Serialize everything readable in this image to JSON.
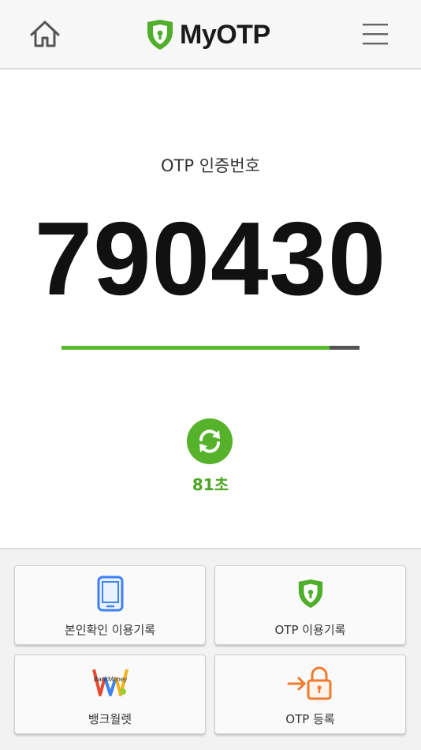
{
  "header": {
    "app_name": "MyOTP",
    "home_icon": "home-icon",
    "menu_icon": "hamburger-menu-icon",
    "brand_color": "#4fae2a"
  },
  "otp": {
    "label": "OTP 인증번호",
    "code": "790430",
    "progress_fraction": 0.9,
    "progress_color": "#5cb82e",
    "remaining_text": "81초",
    "refresh_icon": "refresh-icon"
  },
  "menu_tiles": [
    {
      "label": "본인확인 이용기록",
      "icon": "smartphone-icon"
    },
    {
      "label": "OTP 이용기록",
      "icon": "shield-logo-icon"
    },
    {
      "label": "뱅크월렛",
      "icon": "bankmoney-logo-icon",
      "logo_text": "BankMoney"
    },
    {
      "label": "OTP 등록",
      "icon": "lock-register-icon"
    }
  ]
}
